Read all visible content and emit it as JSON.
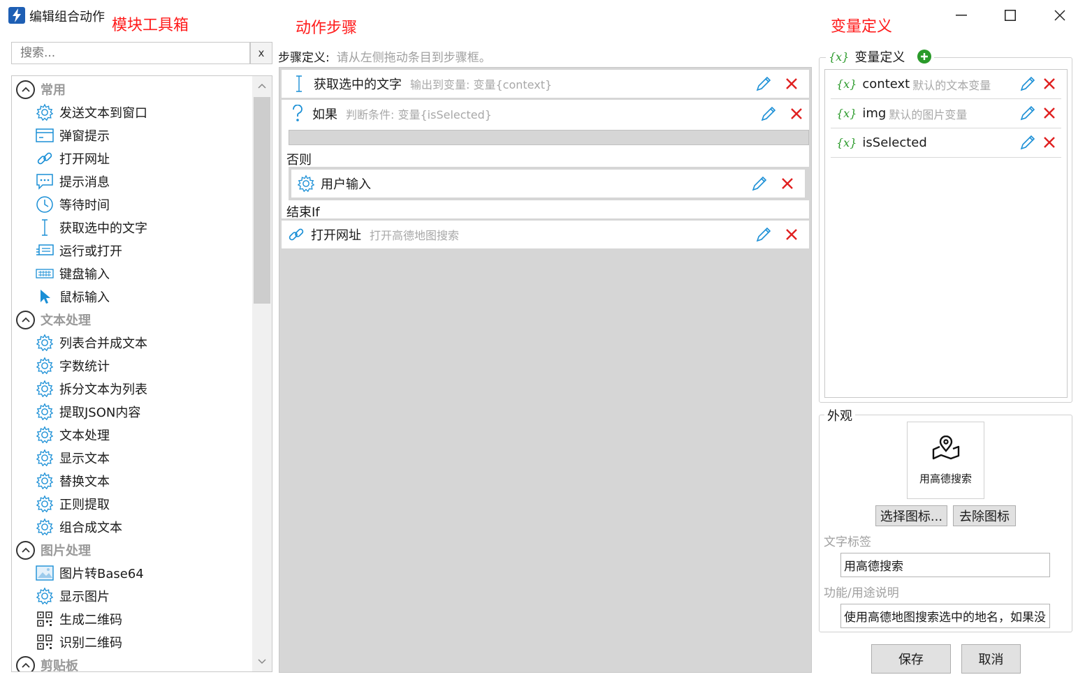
{
  "window": {
    "title": "编辑组合动作",
    "controls": {
      "minimize": "—",
      "maximize": "☐",
      "close": "✕"
    }
  },
  "annotations": {
    "toolbox": "模块工具箱",
    "steps": "动作步骤",
    "variables": "变量定义"
  },
  "toolbox": {
    "search_placeholder": "搜索...",
    "clear_label": "x",
    "groups": [
      {
        "label": "常用",
        "items": [
          {
            "label": "发送文本到窗口",
            "icon": "gear-icon"
          },
          {
            "label": "弹窗提示",
            "icon": "dialog-icon"
          },
          {
            "label": "打开网址",
            "icon": "link-icon"
          },
          {
            "label": "提示消息",
            "icon": "message-icon"
          },
          {
            "label": "等待时间",
            "icon": "clock-icon"
          },
          {
            "label": "获取选中的文字",
            "icon": "text-cursor-icon"
          },
          {
            "label": "运行或打开",
            "icon": "run-icon"
          },
          {
            "label": "键盘输入",
            "icon": "keyboard-icon"
          },
          {
            "label": "鼠标输入",
            "icon": "mouse-pointer-icon"
          }
        ]
      },
      {
        "label": "文本处理",
        "items": [
          {
            "label": "列表合并成文本",
            "icon": "gear-icon"
          },
          {
            "label": "字数统计",
            "icon": "gear-icon"
          },
          {
            "label": "拆分文本为列表",
            "icon": "gear-icon"
          },
          {
            "label": "提取JSON内容",
            "icon": "gear-icon"
          },
          {
            "label": "文本处理",
            "icon": "gear-icon"
          },
          {
            "label": "显示文本",
            "icon": "gear-icon"
          },
          {
            "label": "替换文本",
            "icon": "gear-icon"
          },
          {
            "label": "正则提取",
            "icon": "gear-icon"
          },
          {
            "label": "组合成文本",
            "icon": "gear-icon"
          }
        ]
      },
      {
        "label": "图片处理",
        "items": [
          {
            "label": "图片转Base64",
            "icon": "image-icon"
          },
          {
            "label": "显示图片",
            "icon": "gear-icon"
          },
          {
            "label": "生成二维码",
            "icon": "qrcode-icon"
          },
          {
            "label": "识别二维码",
            "icon": "qrcode-icon"
          }
        ]
      },
      {
        "label": "剪贴板",
        "items": []
      }
    ]
  },
  "steps": {
    "label": "步骤定义:",
    "hint": "请从左侧拖动条目到步骤框。",
    "items": [
      {
        "name": "获取选中的文字",
        "desc": "输出到变量: 变量{context}",
        "icon": "text-cursor-icon"
      },
      {
        "name": "如果",
        "desc": "判断条件: 变量{isSelected}",
        "icon": "question-icon"
      },
      {
        "name": "用户输入",
        "desc": "",
        "icon": "gear-icon"
      },
      {
        "name": "打开网址",
        "desc": "打开高德地图搜索",
        "icon": "link-icon"
      }
    ],
    "else_label": "否则",
    "endif_label": "结束If"
  },
  "variables": {
    "title": "变量定义",
    "symbol": "{x}",
    "items": [
      {
        "name": "context",
        "desc": "默认的文本变量"
      },
      {
        "name": "img",
        "desc": "默认的图片变量"
      },
      {
        "name": "isSelected",
        "desc": ""
      }
    ]
  },
  "appearance": {
    "title": "外观",
    "icon_caption": "用高德搜索",
    "choose_icon_label": "选择图标...",
    "remove_icon_label": "去除图标",
    "text_label_title": "文字标签",
    "text_label_value": "用高德搜索",
    "description_title": "功能/用途说明",
    "description_value": "使用高德地图搜索选中的地名，如果没"
  },
  "footer": {
    "save_label": "保存",
    "cancel_label": "取消"
  },
  "colors": {
    "accent_red": "#ff1a1a",
    "icon_blue": "#1a8fd6",
    "delete_red": "#e02020",
    "variable_green": "#2a9a2a"
  }
}
